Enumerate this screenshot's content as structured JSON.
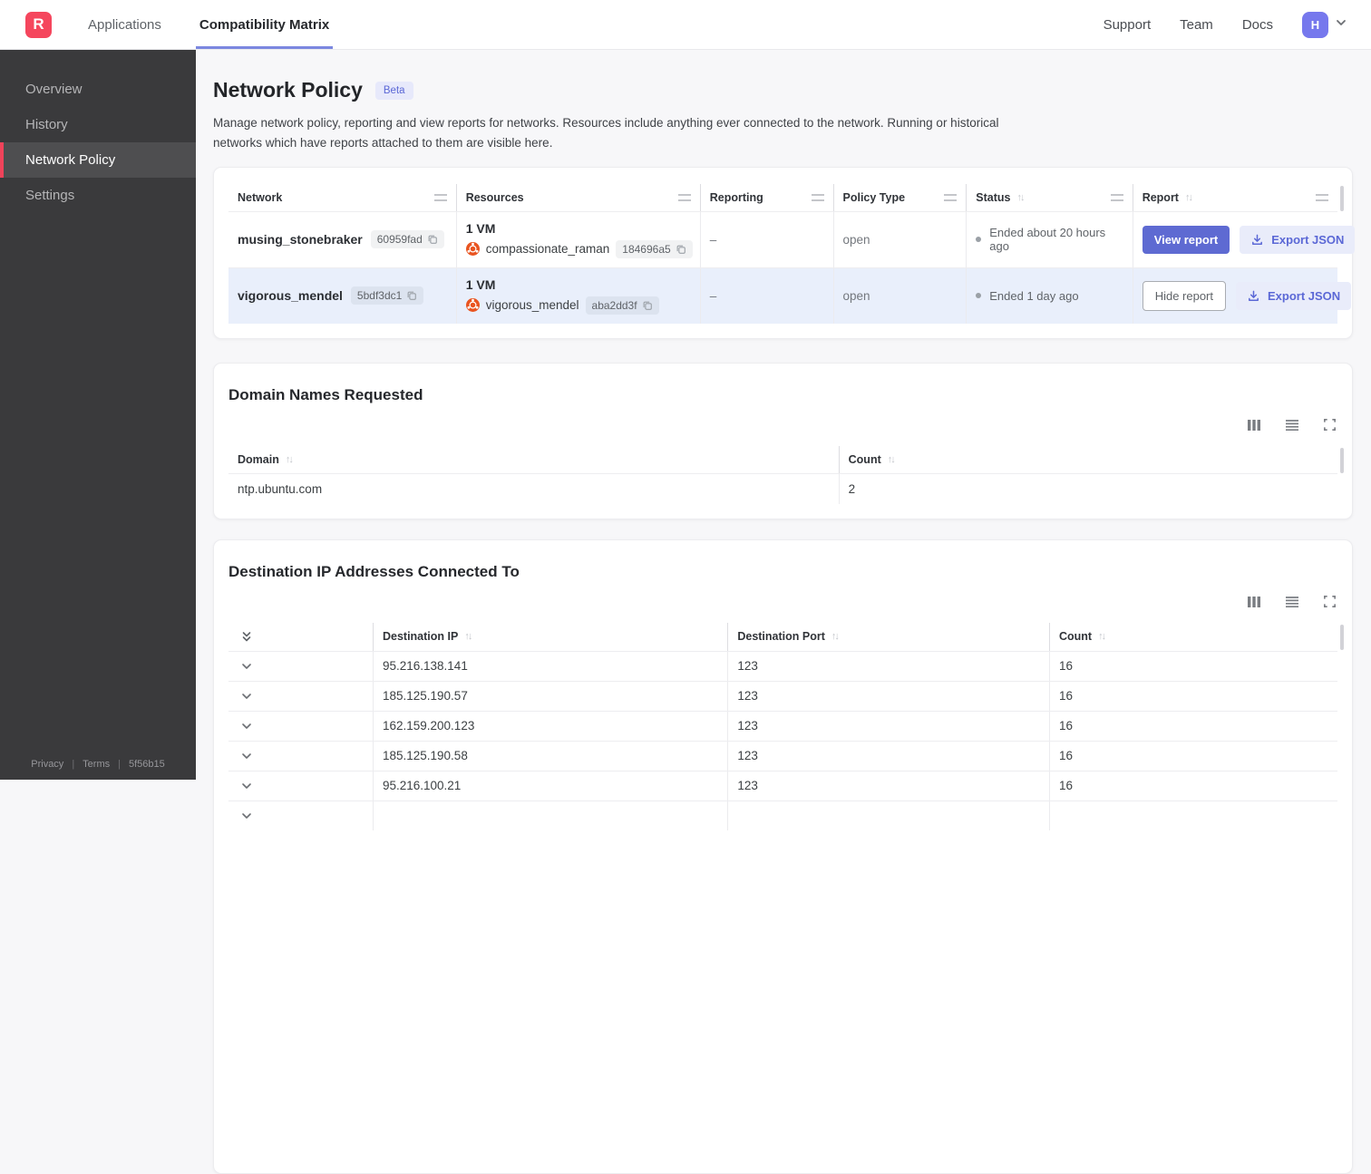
{
  "topnav": {
    "logo_text": "R",
    "tabs": [
      {
        "label": "Applications",
        "active": false
      },
      {
        "label": "Compatibility Matrix",
        "active": true
      }
    ],
    "links": {
      "support": "Support",
      "team": "Team",
      "docs": "Docs"
    },
    "avatar_initial": "H"
  },
  "sidebar": {
    "items": [
      {
        "label": "Overview",
        "active": false
      },
      {
        "label": "History",
        "active": false
      },
      {
        "label": "Network Policy",
        "active": true
      },
      {
        "label": "Settings",
        "active": false
      }
    ],
    "footer": {
      "privacy": "Privacy",
      "terms": "Terms",
      "version": "5f56b15"
    }
  },
  "page": {
    "title": "Network Policy",
    "beta_badge": "Beta",
    "description": "Manage network policy, reporting and view reports for networks. Resources include anything ever connected to the network. Running or historical networks which have reports attached to them are visible here."
  },
  "icons": {
    "sort": "↑↓"
  },
  "colors": {
    "accent_indigo": "#5e6ad2",
    "brand_red": "#f5465d",
    "selected_row": "#e9effb",
    "ubuntu_orange": "#e95420",
    "beta_bg": "#e7e9fb",
    "sidebar_bg": "#3a3a3c",
    "active_tab_underline": "#7b87e0"
  },
  "network_table": {
    "columns": [
      "Network",
      "Resources",
      "Reporting",
      "Policy Type",
      "Status",
      "Report"
    ],
    "rows": [
      {
        "network_name": "musing_stonebraker",
        "network_id": "60959fad",
        "resources_count": "1 VM",
        "resource_name": "compassionate_raman",
        "resource_id": "184696a5",
        "reporting": "–",
        "policy_type": "open",
        "status": "Ended about 20 hours ago",
        "report_button": "View report",
        "export_button": "Export JSON"
      },
      {
        "network_name": "vigorous_mendel",
        "network_id": "5bdf3dc1",
        "resources_count": "1 VM",
        "resource_name": "vigorous_mendel",
        "resource_id": "aba2dd3f",
        "reporting": "–",
        "policy_type": "open",
        "status": "Ended 1 day ago",
        "report_button": "Hide report",
        "export_button": "Export JSON"
      }
    ]
  },
  "domains_card": {
    "title": "Domain Names Requested",
    "columns": [
      "Domain",
      "Count"
    ],
    "rows": [
      {
        "domain": "ntp.ubuntu.com",
        "count": "2"
      }
    ]
  },
  "destinations_card": {
    "title": "Destination IP Addresses Connected To",
    "columns": [
      "Destination IP",
      "Destination Port",
      "Count"
    ],
    "rows": [
      {
        "ip": "95.216.138.141",
        "port": "123",
        "count": "16"
      },
      {
        "ip": "185.125.190.57",
        "port": "123",
        "count": "16"
      },
      {
        "ip": "162.159.200.123",
        "port": "123",
        "count": "16"
      },
      {
        "ip": "185.125.190.58",
        "port": "123",
        "count": "16"
      },
      {
        "ip": "95.216.100.21",
        "port": "123",
        "count": "16"
      },
      {
        "ip": "",
        "port": "",
        "count": ""
      }
    ]
  }
}
